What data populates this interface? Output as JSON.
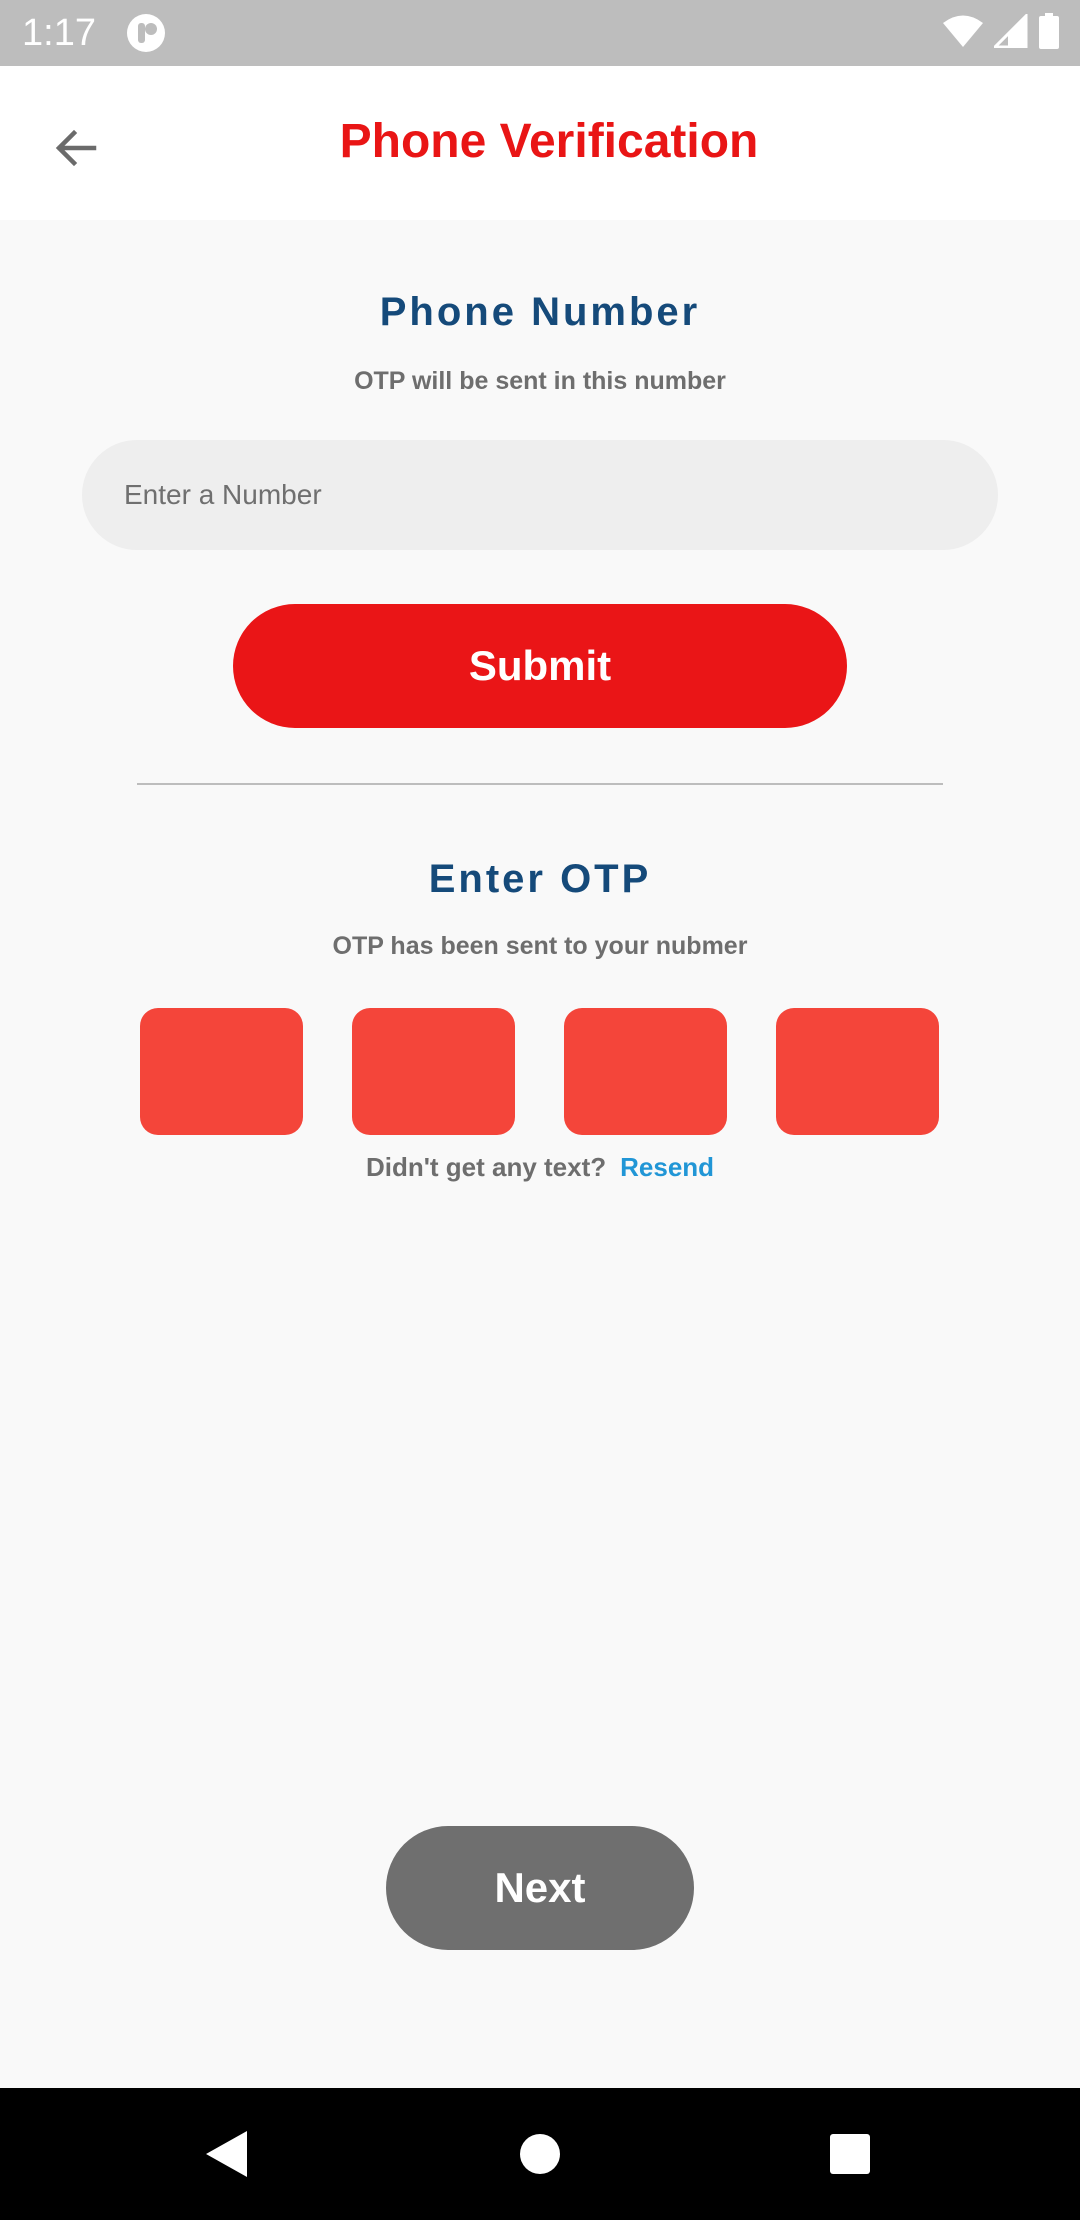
{
  "status_bar": {
    "time": "1:17",
    "icons": [
      "app-notification-icon",
      "wifi-icon",
      "signal-icon",
      "battery-icon"
    ]
  },
  "app_bar": {
    "title": "Phone Verification",
    "back_icon": "arrow-back-icon"
  },
  "phone_section": {
    "heading": "Phone Number",
    "subtitle": "OTP will be sent in this number",
    "input_placeholder": "Enter a Number",
    "input_value": "",
    "submit_label": "Submit"
  },
  "otp_section": {
    "heading": "Enter OTP",
    "subtitle": "OTP has been sent to your nubmer",
    "boxes": [
      "",
      "",
      "",
      ""
    ],
    "resend_question": "Didn't get any text?",
    "resend_label": "Resend"
  },
  "next_label": "Next",
  "nav_bar": {
    "buttons": [
      "back-triangle-icon",
      "home-circle-icon",
      "recents-square-icon"
    ]
  },
  "colors": {
    "title_red": "#e91515",
    "heading_blue": "#154a7a",
    "submit_red": "#ea1517",
    "otp_box": "#f4453a",
    "resend_blue": "#2196d6",
    "next_gray": "#6f6f6f"
  }
}
